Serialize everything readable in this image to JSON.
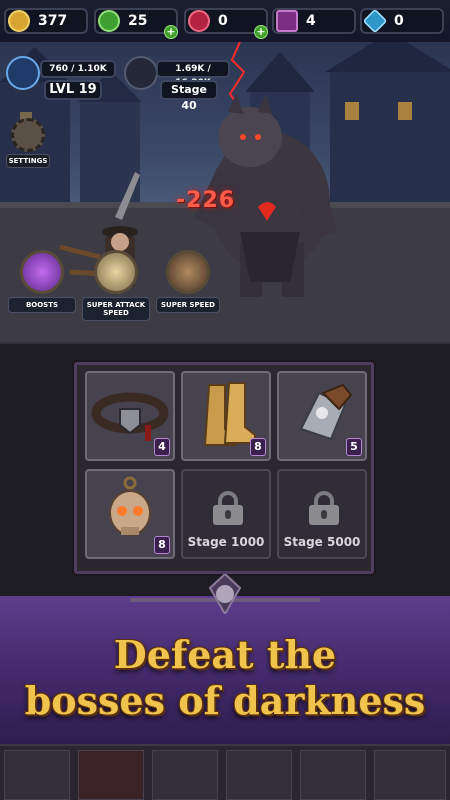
{
  "currencies": [
    {
      "name": "gold",
      "value": "377",
      "icon": "gold-coin-icon",
      "color": "#d8a531"
    },
    {
      "name": "gems-green",
      "value": "25",
      "icon": "green-gem-icon",
      "color": "#4bbf3a"
    },
    {
      "name": "ruby",
      "value": "0",
      "icon": "ruby-icon",
      "color": "#c7284a"
    },
    {
      "name": "spellbook",
      "value": "4",
      "icon": "spellbook-icon",
      "color": "#8a3a8e"
    },
    {
      "name": "diamond",
      "value": "0",
      "icon": "diamond-icon",
      "color": "#41b6e6"
    }
  ],
  "hero": {
    "xp": "760 / 1.10K",
    "level": "LVL 19"
  },
  "boss": {
    "hp": "1.69K / 16.20K",
    "stage": "Stage 40"
  },
  "settings_label": "SETTINGS",
  "skills": [
    {
      "label": "BOOSTS"
    },
    {
      "label": "SUPER ATTACK SPEED"
    },
    {
      "label": "SUPER SPEED"
    }
  ],
  "damage_text": "-226",
  "inventory": {
    "slots": [
      {
        "item": "belt",
        "level": "4"
      },
      {
        "item": "boots",
        "level": "8"
      },
      {
        "item": "gauntlet",
        "level": "5"
      },
      {
        "item": "skull-amulet",
        "level": "8"
      },
      {
        "item": "locked",
        "unlock": "Stage 1000"
      },
      {
        "item": "locked",
        "unlock": "Stage 5000"
      }
    ]
  },
  "banner": {
    "line1": "Defeat the",
    "line2": "bosses of darkness"
  },
  "colors": {
    "accent_gold": "#f0c34c",
    "banner_purple": "#4a2f78",
    "panel_border": "#4e3d60"
  }
}
